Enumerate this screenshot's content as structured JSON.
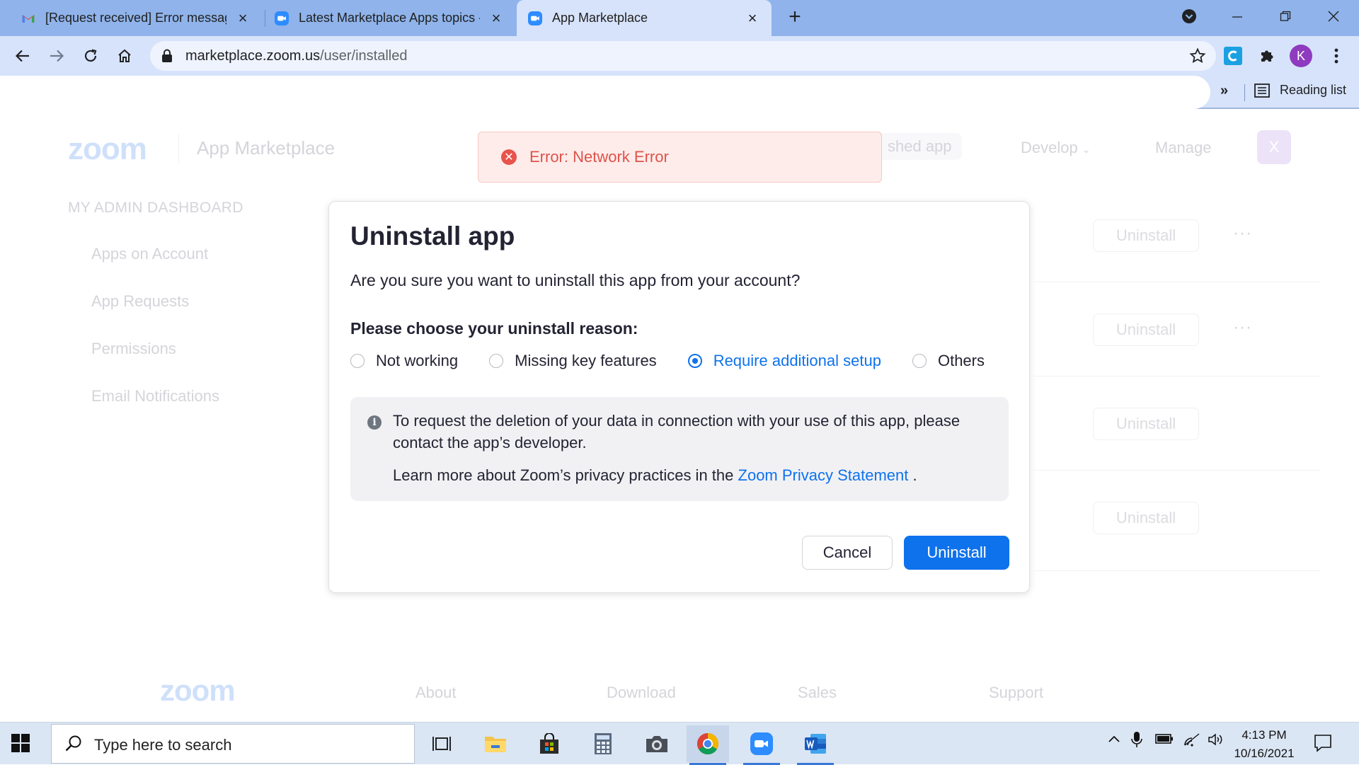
{
  "browser": {
    "tabs": [
      {
        "title": "[Request received] Error message",
        "favicon": "gmail-icon",
        "active": false
      },
      {
        "title": "Latest Marketplace Apps topics -",
        "favicon": "zoom-icon",
        "active": false
      },
      {
        "title": "App Marketplace",
        "favicon": "zoom-icon",
        "active": true
      }
    ],
    "url_host": "marketplace.zoom.us",
    "url_path": "/user/installed",
    "profile_initial": "K",
    "reading_list": "Reading list",
    "more_bookmarks": "»"
  },
  "page": {
    "logo": "zoom",
    "title": "App Marketplace",
    "header_links": {
      "published": "shed app",
      "develop": "Develop",
      "manage": "Manage"
    },
    "avatar": "X",
    "sidebar_heading": "MY ADMIN DASHBOARD",
    "sidebar_items": [
      "Apps on Account",
      "App Requests",
      "Permissions",
      "Email Notifications"
    ],
    "row_uninstall": "Uninstall",
    "row_more": "···",
    "footer_links": [
      "About",
      "Download",
      "Sales",
      "Support"
    ]
  },
  "toast": {
    "message": "Error: Network Error"
  },
  "modal": {
    "title": "Uninstall app",
    "question": "Are you sure you want to uninstall this app from your account?",
    "reason_label": "Please choose your uninstall reason:",
    "reasons": [
      "Not working",
      "Missing key features",
      "Require additional setup",
      "Others"
    ],
    "selected_reason": "Require additional setup",
    "info_text": "To request the deletion of your data in connection with your use of this app, please contact the app’s developer.",
    "privacy_prefix": "Learn more about Zoom’s privacy practices in the",
    "privacy_link": "Zoom Privacy Statement",
    "privacy_suffix": ".",
    "cancel_label": "Cancel",
    "uninstall_label": "Uninstall"
  },
  "taskbar": {
    "search_placeholder": "Type here to search",
    "time": "4:13 PM",
    "date": "10/16/2021"
  },
  "colors": {
    "accent": "#0e72ed",
    "error": "#e8534b",
    "chrome_frame": "#8fb3ea"
  }
}
